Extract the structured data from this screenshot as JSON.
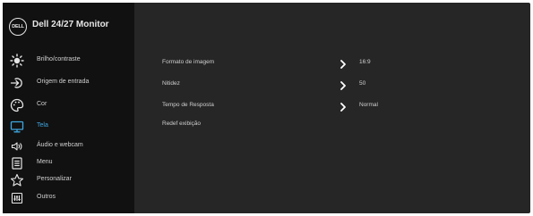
{
  "app": {
    "title": "Dell 24/27 Monitor",
    "logo_text": "DELL"
  },
  "colors": {
    "accent": "#3fa7e0",
    "sidebar_bg": "#111111",
    "content_bg": "#262626",
    "text": "#d0d0d0"
  },
  "sidebar": {
    "active_index": 3,
    "items": [
      {
        "label": "Brilho/contraste",
        "icon": "brightness-icon"
      },
      {
        "label": "Origem de entrada",
        "icon": "input-source-icon"
      },
      {
        "label": "Cor",
        "icon": "color-palette-icon"
      },
      {
        "label": "Tela",
        "icon": "display-icon"
      },
      {
        "label": "Áudio e webcam",
        "icon": "speaker-icon"
      },
      {
        "label": "Menu",
        "icon": "menu-icon"
      },
      {
        "label": "Personalizar",
        "icon": "star-icon"
      },
      {
        "label": "Outros",
        "icon": "others-icon"
      }
    ]
  },
  "main": {
    "rows": [
      {
        "label": "Formato de imagem",
        "value": "16:9"
      },
      {
        "label": "Nitidez",
        "value": "50"
      },
      {
        "label": "Tempo de Resposta",
        "value": "Normal"
      },
      {
        "label": "Redef exibição",
        "value": ""
      }
    ]
  }
}
